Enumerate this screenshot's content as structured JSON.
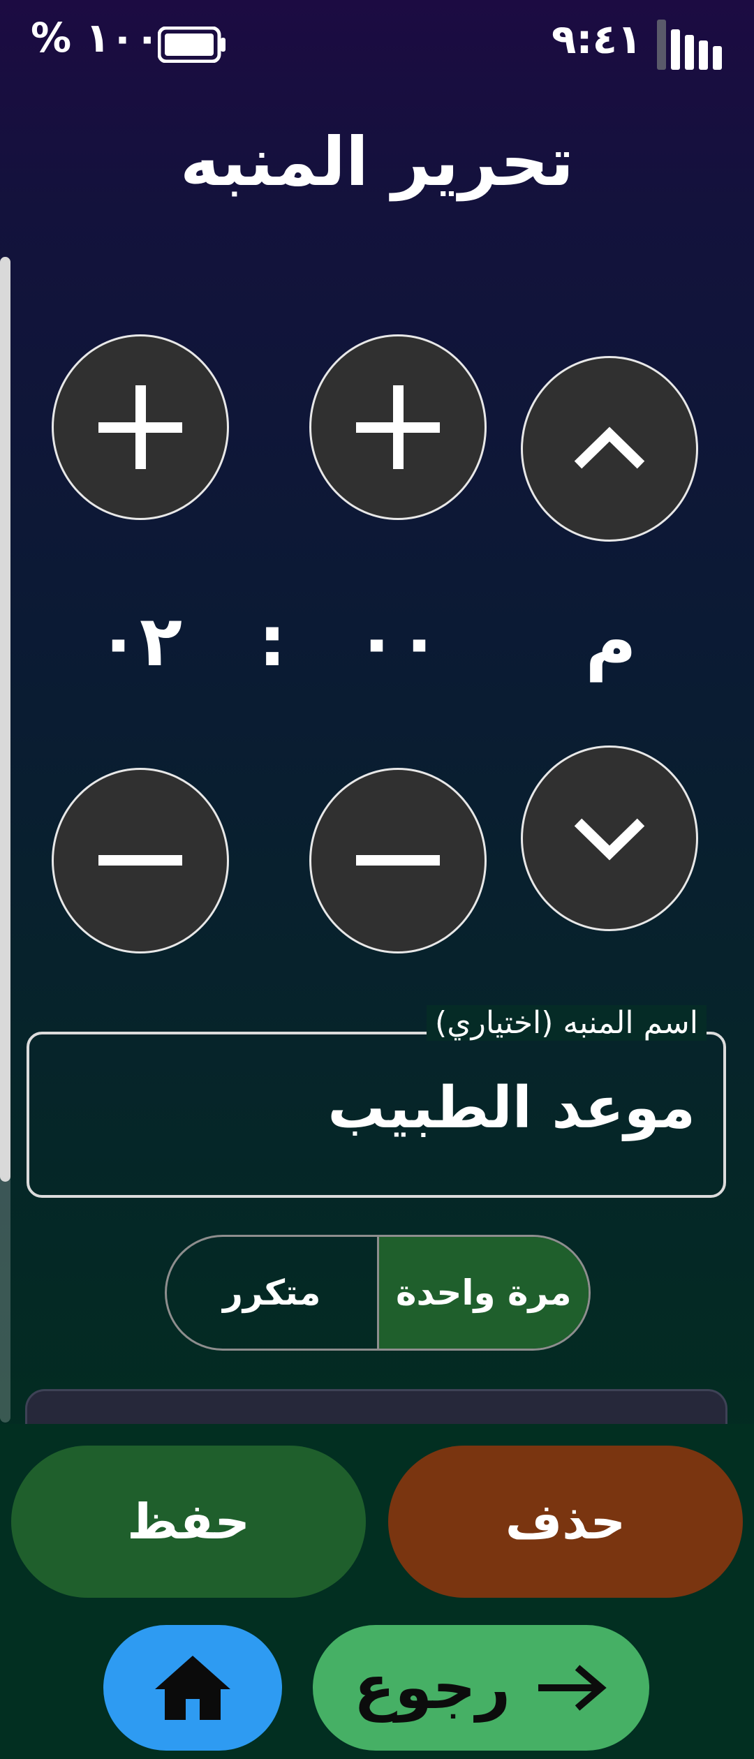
{
  "status_bar": {
    "time": "٩:٤١",
    "battery_text": "١٠٠ %",
    "icons": [
      "signal-icon",
      "battery-icon"
    ]
  },
  "screen": {
    "title": "تحرير المنبه"
  },
  "time_picker": {
    "period": "م",
    "minute": "٠٠",
    "separator": ":",
    "hour": "٠٢",
    "icons": [
      "chevron-up-icon",
      "plus-icon",
      "chevron-down-icon",
      "minus-icon"
    ]
  },
  "alarm_name": {
    "label": "اسم المنبه (اختياري)",
    "value": "موعد الطبيب"
  },
  "repeat_toggle": {
    "options": [
      "مرة واحدة",
      "متكرر"
    ],
    "selected": "مرة واحدة"
  },
  "actions": {
    "delete_label": "حذف",
    "save_label": "حفظ"
  },
  "navigation": {
    "back_label": "رجوع",
    "icons": [
      "home-icon",
      "arrow-right-icon"
    ]
  },
  "colors": {
    "delete": "#7a3510",
    "save": "#1f5f2c",
    "home": "#2e9bf2",
    "back": "#46b065",
    "picker_button": "#303030"
  }
}
